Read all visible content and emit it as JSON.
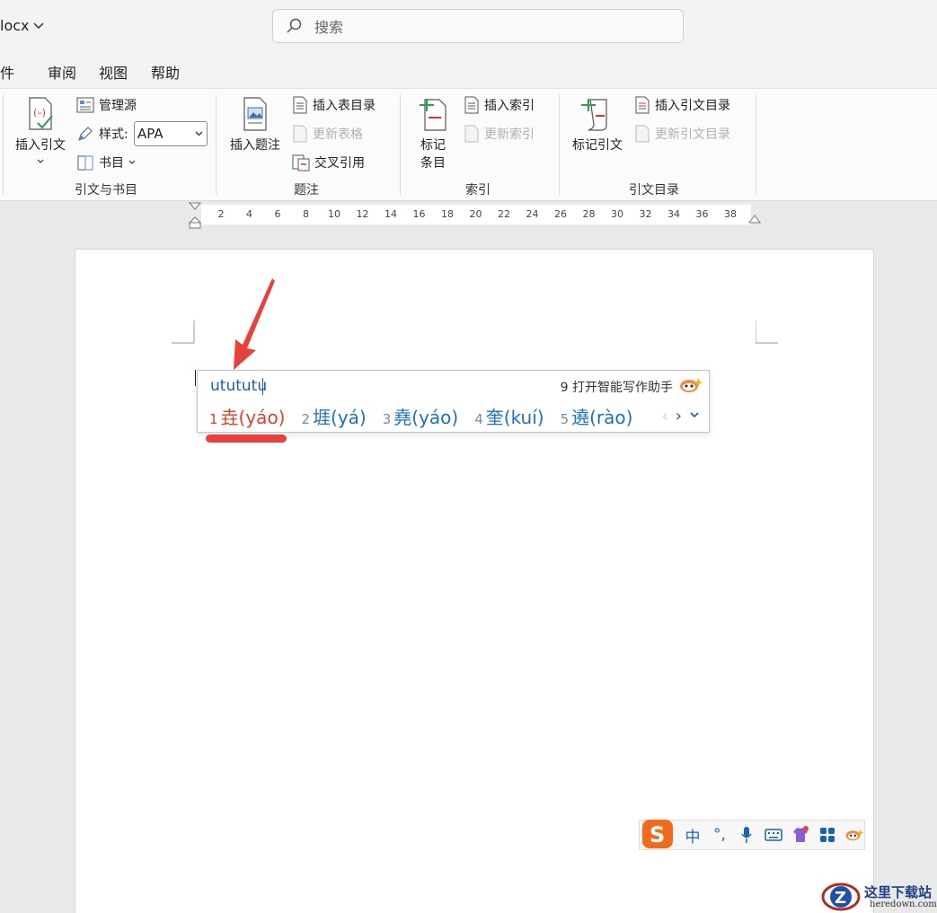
{
  "titlebar": {
    "doc_name": "locx",
    "search_placeholder": "搜索"
  },
  "menu": {
    "tabs": [
      "邮件",
      "审阅",
      "视图",
      "帮助"
    ]
  },
  "ribbon": {
    "citations_group": {
      "label": "引文与书目",
      "insert_citation": "插入引文",
      "manage_sources": "管理源",
      "style_label": "样式:",
      "style_value": "APA",
      "bibliography": "书目"
    },
    "captions_group": {
      "label": "题注",
      "insert_caption": "插入题注",
      "insert_table_of_figures": "插入表目录",
      "update_table": "更新表格",
      "cross_reference": "交叉引用"
    },
    "index_group": {
      "label": "索引",
      "mark_entry": "标记条目",
      "mark_entry_line1": "标记",
      "mark_entry_line2": "条目",
      "insert_index": "插入索引",
      "update_index": "更新索引"
    },
    "toa_group": {
      "label": "引文目录",
      "mark_citation": "标记引文",
      "insert_toa": "插入引文目录",
      "update_toa": "更新引文目录"
    }
  },
  "ruler": {
    "ticks": [
      "2",
      "4",
      "6",
      "8",
      "10",
      "12",
      "14",
      "16",
      "18",
      "20",
      "22",
      "24",
      "26",
      "28",
      "30",
      "32",
      "34",
      "36",
      "38"
    ]
  },
  "ime": {
    "input": "utututu",
    "assistant": "9 打开智能写作助手",
    "candidates": [
      {
        "num": "1",
        "text": "垚(yáo)"
      },
      {
        "num": "2",
        "text": "堐(yá)"
      },
      {
        "num": "3",
        "text": "堯(yáo)"
      },
      {
        "num": "4",
        "text": "奎(kuí)"
      },
      {
        "num": "5",
        "text": "遶(rào)"
      }
    ],
    "toolbar": {
      "lang": "中",
      "punct": "°,"
    }
  },
  "watermark": {
    "cn": "这里下载站",
    "en": "heredown.com"
  },
  "colors": {
    "accent_red": "#e8413a",
    "ime_blue": "#1a72c0",
    "sogou_orange": "#f26b1d"
  }
}
